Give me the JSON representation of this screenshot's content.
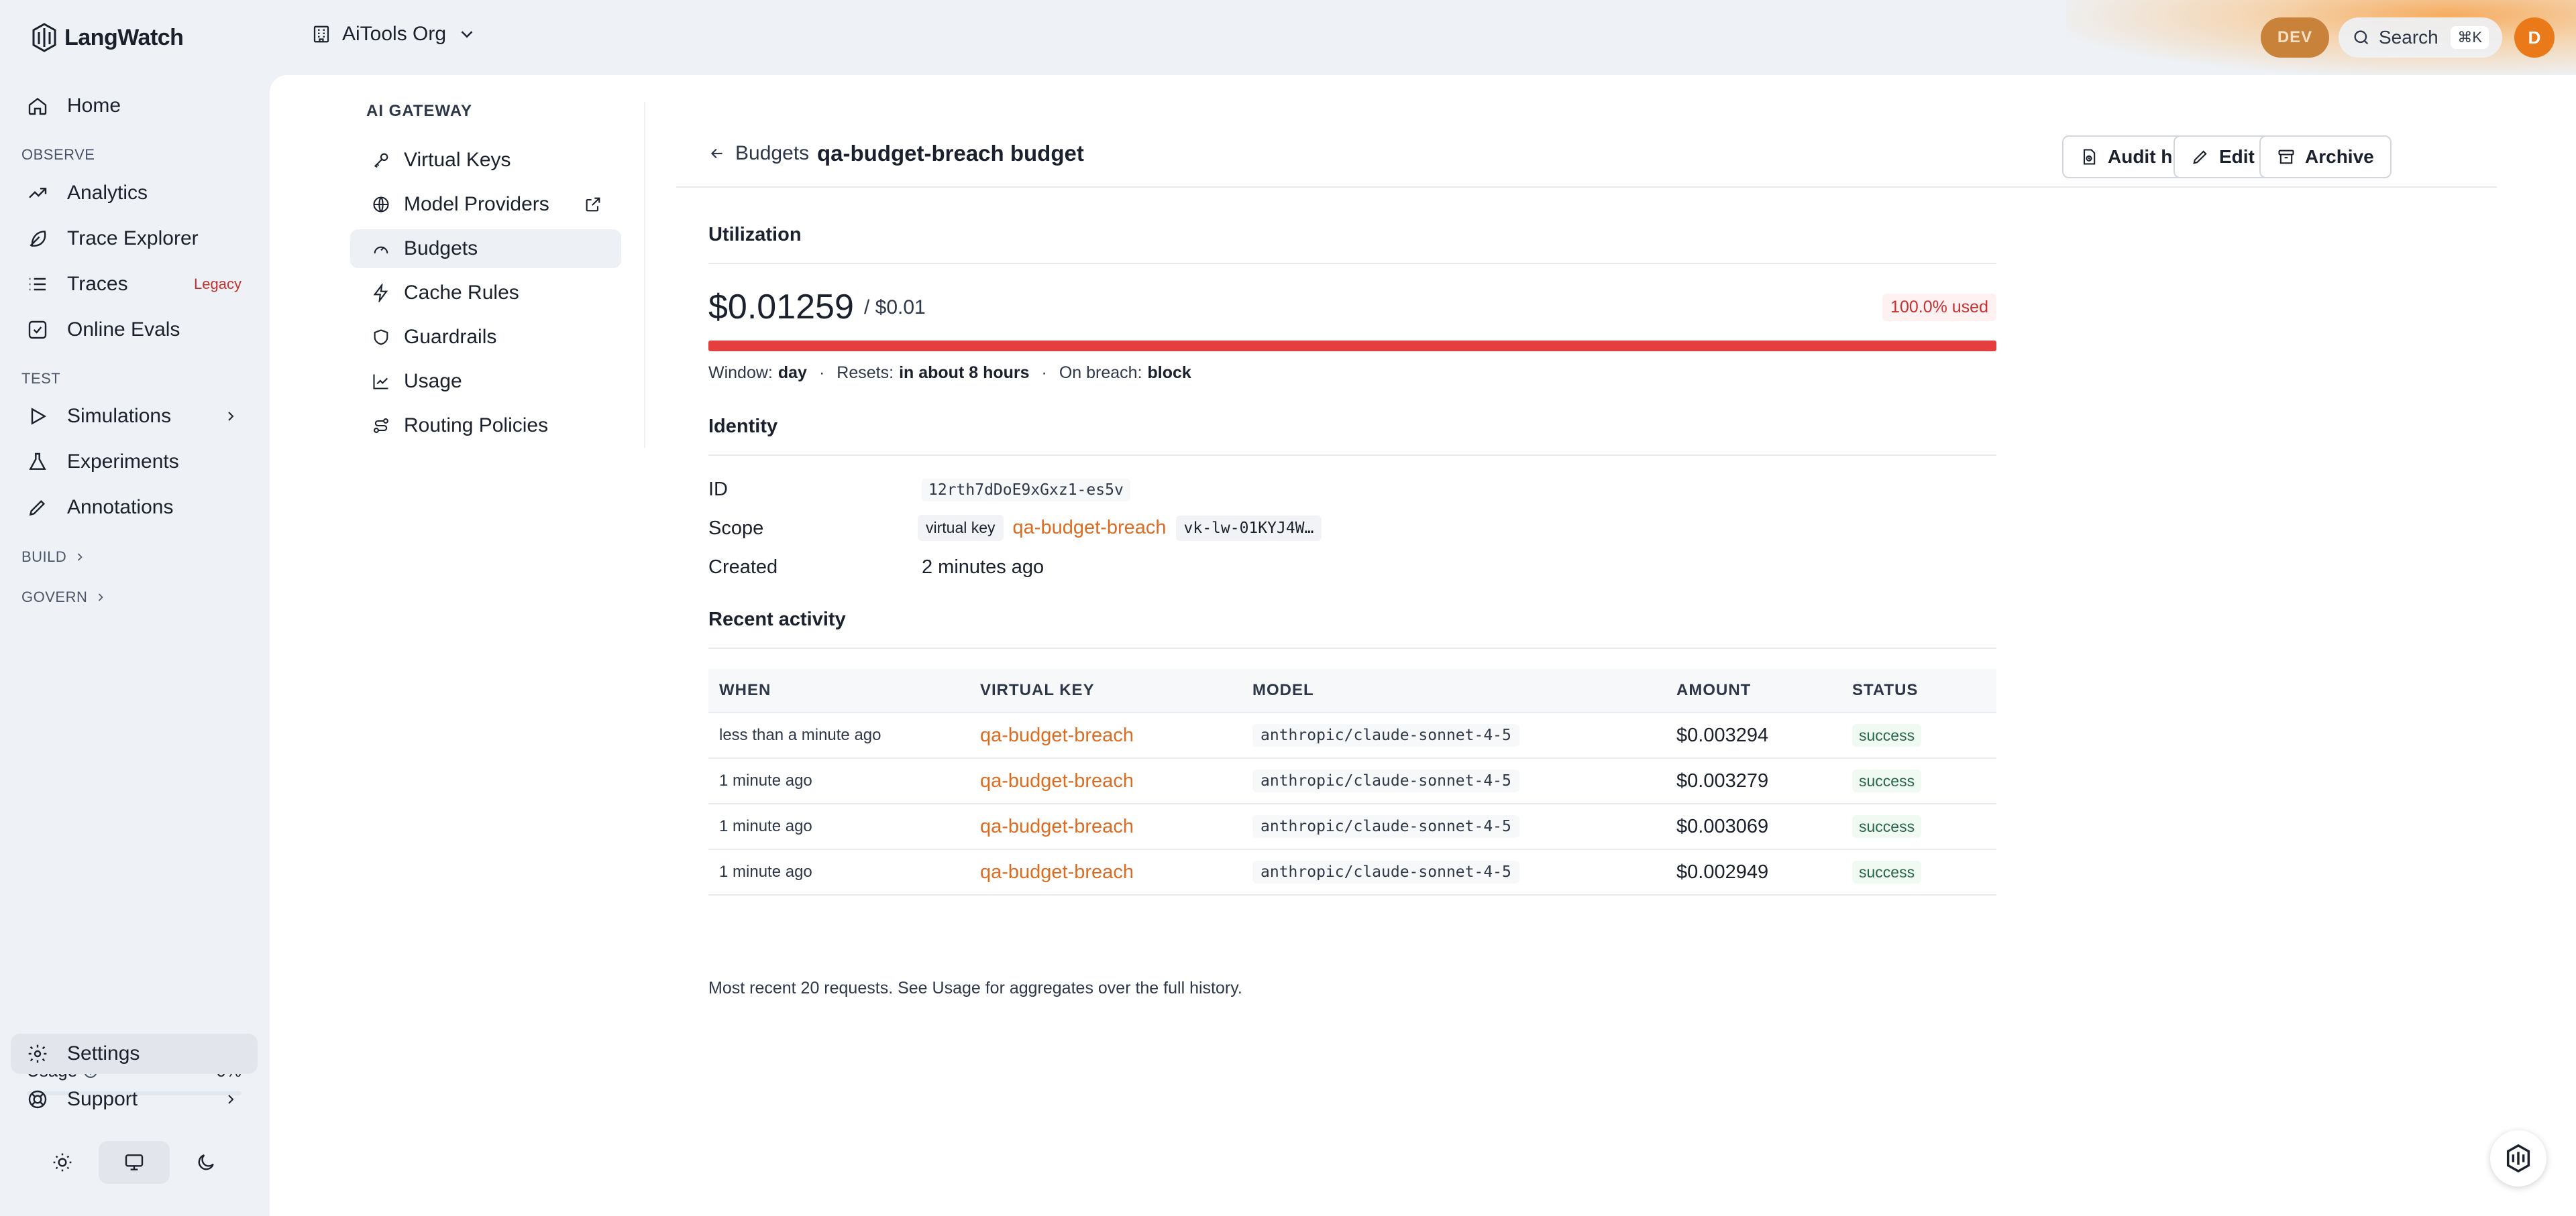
{
  "app": {
    "name": "LangWatch",
    "org": "AiTools Org"
  },
  "topbar": {
    "env_badge": "DEV",
    "search_label": "Search",
    "search_kbd": "⌘K",
    "avatar_initial": "D",
    "accent": "#ea7a19"
  },
  "sidebar": {
    "home": "Home",
    "sections": {
      "observe": "OBSERVE",
      "test": "TEST",
      "build": "BUILD",
      "govern": "GOVERN"
    },
    "observe_items": [
      "Analytics",
      "Trace Explorer",
      "Traces",
      "Online Evals"
    ],
    "traces_badge": "Legacy",
    "test_items": [
      "Simulations",
      "Experiments",
      "Annotations"
    ],
    "usage_label": "Usage",
    "usage_pct": "0%",
    "usage_value": 0,
    "settings": "Settings",
    "support": "Support"
  },
  "subnav": {
    "title": "AI GATEWAY",
    "items": [
      "Virtual Keys",
      "Model Providers",
      "Budgets",
      "Cache Rules",
      "Guardrails",
      "Usage",
      "Routing Policies"
    ],
    "active": "Budgets"
  },
  "header": {
    "back_label": "Budgets",
    "title": "qa-budget-breach budget",
    "buttons": {
      "audit": "Audit history",
      "edit": "Edit",
      "archive": "Archive"
    }
  },
  "utilization": {
    "title": "Utilization",
    "spent": "$0.01259",
    "limit": "/ $0.01",
    "used_label": "100.0% used",
    "used_fraction": 1.0,
    "window_label": "Window:",
    "window_value": "day",
    "resets_label": "Resets:",
    "resets_value": "in about 8 hours",
    "breach_label": "On breach:",
    "breach_value": "block",
    "bar_color": "#e53e3e"
  },
  "identity": {
    "title": "Identity",
    "id_label": "ID",
    "id_value": "12rth7dDoE9xGxz1-es5v",
    "scope_label": "Scope",
    "scope_tag": "virtual key",
    "scope_name": "qa-budget-breach",
    "scope_key": "vk-lw-01KYJ4W…",
    "created_label": "Created",
    "created_value": "2 minutes ago"
  },
  "activity": {
    "title": "Recent activity",
    "columns": [
      "WHEN",
      "VIRTUAL KEY",
      "MODEL",
      "AMOUNT",
      "STATUS"
    ],
    "rows": [
      {
        "when": "less than a minute ago",
        "key": "qa-budget-breach",
        "model": "anthropic/claude-sonnet-4-5",
        "amount": "$0.003294",
        "status": "success"
      },
      {
        "when": "1 minute ago",
        "key": "qa-budget-breach",
        "model": "anthropic/claude-sonnet-4-5",
        "amount": "$0.003279",
        "status": "success"
      },
      {
        "when": "1 minute ago",
        "key": "qa-budget-breach",
        "model": "anthropic/claude-sonnet-4-5",
        "amount": "$0.003069",
        "status": "success"
      },
      {
        "when": "1 minute ago",
        "key": "qa-budget-breach",
        "model": "anthropic/claude-sonnet-4-5",
        "amount": "$0.002949",
        "status": "success"
      }
    ],
    "footnote": "Most recent 20 requests. See Usage for aggregates over the full history."
  }
}
